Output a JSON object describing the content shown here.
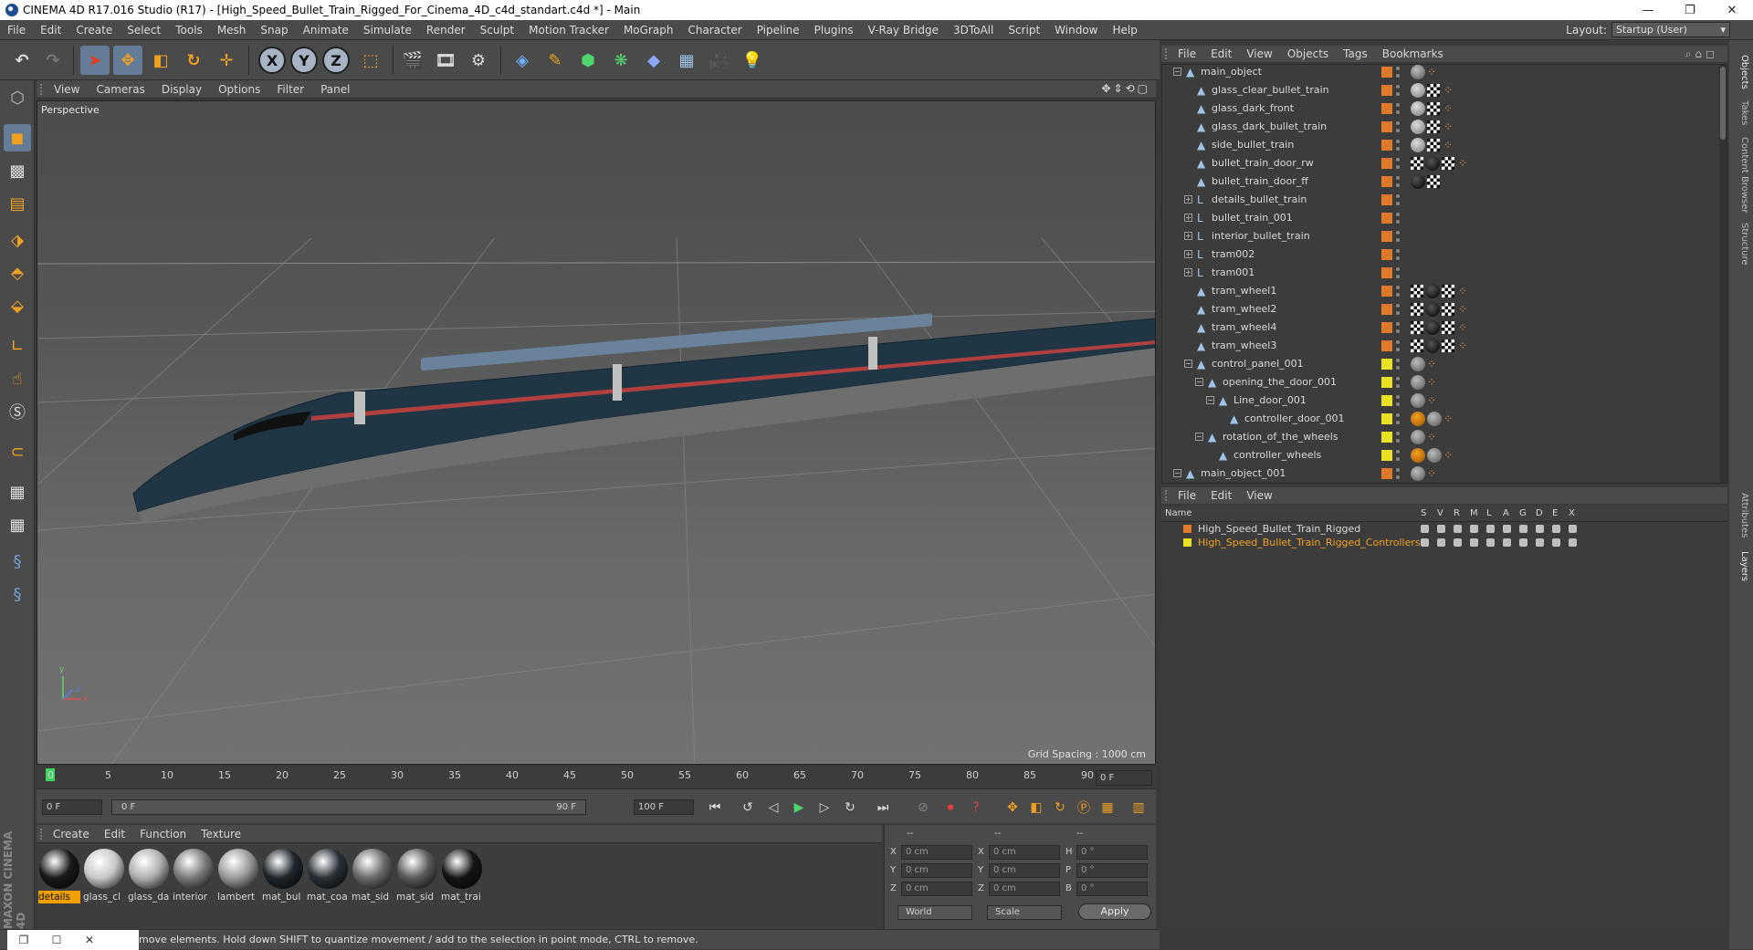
{
  "window": {
    "title": "CINEMA 4D R17.016 Studio (R17) - [High_Speed_Bullet_Train_Rigged_For_Cinema_4D_c4d_standart.c4d *] - Main",
    "min": "—",
    "max": "❐",
    "close": "✕"
  },
  "menubar": {
    "items": [
      "File",
      "Edit",
      "Create",
      "Select",
      "Tools",
      "Mesh",
      "Snap",
      "Animate",
      "Simulate",
      "Render",
      "Sculpt",
      "Motion Tracker",
      "MoGraph",
      "Character",
      "Pipeline",
      "Plugins",
      "V-Ray Bridge",
      "3DToAll",
      "Script",
      "Window",
      "Help"
    ],
    "layout_label": "Layout:",
    "layout_value": "Startup (User)"
  },
  "toolbar": {
    "axis_x": "X",
    "axis_y": "Y",
    "axis_z": "Z"
  },
  "viewport": {
    "menu": [
      "View",
      "Cameras",
      "Display",
      "Options",
      "Filter",
      "Panel"
    ],
    "label": "Perspective",
    "grid_spacing": "Grid Spacing : 1000 cm",
    "axis_x": "x",
    "axis_y": "y",
    "axis_z": "z"
  },
  "timeline": {
    "ticks": [
      "0",
      "5",
      "10",
      "15",
      "20",
      "25",
      "30",
      "35",
      "40",
      "45",
      "50",
      "55",
      "60",
      "65",
      "70",
      "75",
      "80",
      "85",
      "90"
    ],
    "current_frame": "0 F",
    "start_field": "0 F",
    "range_start": "0 F",
    "range_end": "90 F",
    "end_field": "100 F"
  },
  "materials": {
    "menu": [
      "Create",
      "Edit",
      "Function",
      "Texture"
    ],
    "items": [
      {
        "label": "details",
        "color": "#1a1a1a"
      },
      {
        "label": "glass_cl",
        "color": "#c8c8c8"
      },
      {
        "label": "glass_da",
        "color": "#b0b0b0"
      },
      {
        "label": "interior",
        "color": "#7a7a7a"
      },
      {
        "label": "lambert",
        "color": "#9a9a9a"
      },
      {
        "label": "mat_bul",
        "color": "#20262b"
      },
      {
        "label": "mat_coa",
        "color": "#2a3036"
      },
      {
        "label": "mat_sid",
        "color": "#6a6a6a"
      },
      {
        "label": "mat_sid",
        "color": "#5a5a5a"
      },
      {
        "label": "mat_trai",
        "color": "#151515"
      }
    ]
  },
  "coords": {
    "header_dashes": [
      "--",
      "--",
      "--"
    ],
    "rows": [
      {
        "l1": "X",
        "v1": "0 cm",
        "l2": "X",
        "v2": "0 cm",
        "l3": "H",
        "v3": "0 °"
      },
      {
        "l1": "Y",
        "v1": "0 cm",
        "l2": "Y",
        "v2": "0 cm",
        "l3": "P",
        "v3": "0 °"
      },
      {
        "l1": "Z",
        "v1": "0 cm",
        "l2": "Z",
        "v2": "0 cm",
        "l3": "B",
        "v3": "0 °"
      }
    ],
    "space": "World",
    "mode": "Scale",
    "apply": "Apply"
  },
  "status": {
    "text": "move elements. Hold down SHIFT to quantize movement / add to the selection in point mode, CTRL to remove."
  },
  "objects": {
    "menu": [
      "File",
      "Edit",
      "View",
      "Objects",
      "Tags",
      "Bookmarks"
    ],
    "rows": [
      {
        "name": "main_object",
        "indent": 0,
        "color": "#e07a2a",
        "tags": "partial"
      },
      {
        "name": "glass_clear_bullet_train",
        "indent": 1,
        "color": "#e07a2a",
        "tags": "g"
      },
      {
        "name": "glass_dark_front",
        "indent": 1,
        "color": "#e07a2a",
        "tags": "g"
      },
      {
        "name": "glass_dark_bullet_train",
        "indent": 1,
        "color": "#e07a2a",
        "tags": "g"
      },
      {
        "name": "side_bullet_train",
        "indent": 1,
        "color": "#e07a2a",
        "tags": "g"
      },
      {
        "name": "bullet_train_door_rw",
        "indent": 1,
        "color": "#e07a2a",
        "tags": "w"
      },
      {
        "name": "bullet_train_door_ff",
        "indent": 1,
        "color": "#e07a2a",
        "tags": "b"
      },
      {
        "name": "details_bullet_train",
        "indent": 1,
        "color": "#e07a2a",
        "tags": "none"
      },
      {
        "name": "bullet_train_001",
        "indent": 1,
        "color": "#e07a2a",
        "tags": "none"
      },
      {
        "name": "interior_bullet_train",
        "indent": 1,
        "color": "#e07a2a",
        "tags": "none"
      },
      {
        "name": "tram002",
        "indent": 1,
        "color": "#e07a2a",
        "tags": "none"
      },
      {
        "name": "tram001",
        "indent": 1,
        "color": "#e07a2a",
        "tags": "none"
      },
      {
        "name": "tram_wheel1",
        "indent": 1,
        "color": "#e07a2a",
        "tags": "w"
      },
      {
        "name": "tram_wheel2",
        "indent": 1,
        "color": "#e07a2a",
        "tags": "w"
      },
      {
        "name": "tram_wheel4",
        "indent": 1,
        "color": "#e07a2a",
        "tags": "w"
      },
      {
        "name": "tram_wheel3",
        "indent": 1,
        "color": "#e07a2a",
        "tags": "w"
      },
      {
        "name": "control_panel_001",
        "indent": 1,
        "color": "#e8e020",
        "tags": "c"
      },
      {
        "name": "opening_the_door_001",
        "indent": 2,
        "color": "#e8e020",
        "tags": "c"
      },
      {
        "name": "Line_door_001",
        "indent": 3,
        "color": "#e8e020",
        "tags": "c"
      },
      {
        "name": "controller_door_001",
        "indent": 4,
        "color": "#e8e020",
        "tags": "x"
      },
      {
        "name": "rotation_of_the_wheels",
        "indent": 2,
        "color": "#e8e020",
        "tags": "c"
      },
      {
        "name": "controller_wheels",
        "indent": 3,
        "color": "#e8e020",
        "tags": "x"
      },
      {
        "name": "main_object_001",
        "indent": 0,
        "color": "#e07a2a",
        "tags": "c"
      }
    ]
  },
  "right_tabs": [
    "Objects",
    "Takes",
    "Content Browser",
    "Structure",
    "Attributes",
    "Layers"
  ],
  "layers": {
    "menu": [
      "File",
      "Edit",
      "View"
    ],
    "headers": [
      "Name",
      "S",
      "V",
      "R",
      "M",
      "L",
      "A",
      "G",
      "D",
      "E",
      "X"
    ],
    "rows": [
      {
        "name": "High_Speed_Bullet_Train_Rigged",
        "color": "#e07a2a",
        "text_color": "#d8d8d8"
      },
      {
        "name": "High_Speed_Bullet_Train_Rigged_Controllers",
        "color": "#e8e020",
        "text_color": "#f0a020"
      }
    ]
  },
  "taskbar": {
    "restore": "❐",
    "max": "☐",
    "close": "✕"
  }
}
